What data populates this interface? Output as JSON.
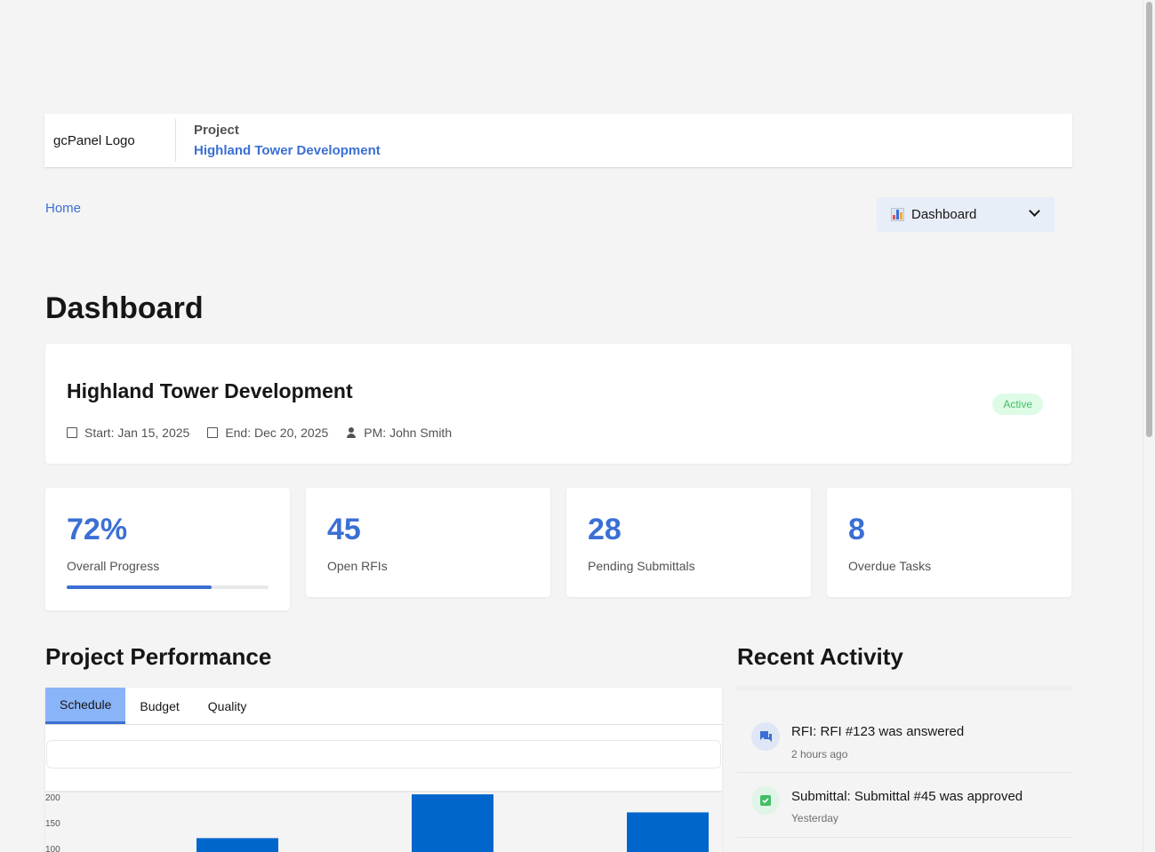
{
  "header": {
    "logo_alt": "gcPanel Logo",
    "project_label": "Project",
    "project_name": "Highland Tower Development"
  },
  "breadcrumb": {
    "home": "Home"
  },
  "nav_select": {
    "icon": "bar-chart-icon",
    "value": "Dashboard"
  },
  "page_title": "Dashboard",
  "project_card": {
    "name": "Highland Tower Development",
    "start": "Start: Jan 15, 2025",
    "end": "End: Dec 20, 2025",
    "pm": "PM: John Smith",
    "status": "Active"
  },
  "stats": [
    {
      "value": "72%",
      "label": "Overall Progress",
      "progress": 0.72
    },
    {
      "value": "45",
      "label": "Open RFIs"
    },
    {
      "value": "28",
      "label": "Pending Submittals"
    },
    {
      "value": "8",
      "label": "Overdue Tasks"
    }
  ],
  "performance": {
    "title": "Project Performance",
    "tabs": [
      "Schedule",
      "Budget",
      "Quality"
    ],
    "active_tab": "Schedule"
  },
  "chart_data": {
    "type": "bar",
    "y_ticks": [
      "200",
      "150",
      "100"
    ],
    "values": [
      120,
      205,
      170
    ],
    "ylim": [
      100,
      205
    ],
    "color": "#0066cc"
  },
  "activity": {
    "title": "Recent Activity",
    "items": [
      {
        "icon": "chat-icon",
        "text": "RFI: RFI #123 was answered",
        "time": "2 hours ago",
        "color": "#3b6fd4"
      },
      {
        "icon": "check-shield-icon",
        "text": "Submittal: Submittal #45 was approved",
        "time": "Yesterday",
        "color": "#42be65"
      }
    ]
  },
  "colors": {
    "accent": "#3b6fd4",
    "success": "#42be65",
    "tab_active": "#8ab4f8"
  }
}
